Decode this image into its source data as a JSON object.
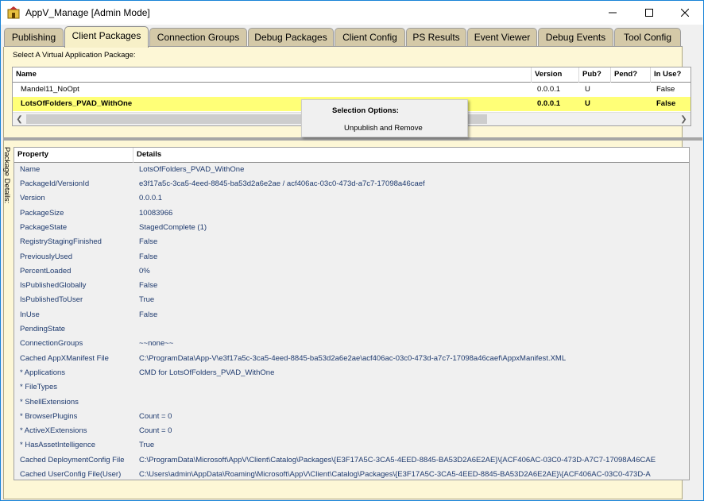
{
  "window": {
    "title": "AppV_Manage [Admin Mode]"
  },
  "tabs": [
    {
      "label": "Publishing",
      "active": false
    },
    {
      "label": "Client Packages",
      "active": true
    },
    {
      "label": "Connection Groups",
      "active": false
    },
    {
      "label": "Debug Packages",
      "active": false
    },
    {
      "label": "Client Config",
      "active": false
    },
    {
      "label": "PS Results",
      "active": false
    },
    {
      "label": "Event Viewer",
      "active": false
    },
    {
      "label": "Debug Events",
      "active": false
    },
    {
      "label": "Tool Config",
      "active": false
    }
  ],
  "packages": {
    "label": "Select A Virtual Application Package:",
    "columns": {
      "name": "Name",
      "version": "Version",
      "pub": "Pub?",
      "pend": "Pend?",
      "inuse": "In Use?"
    },
    "rows": [
      {
        "name": "Mandel11_NoOpt",
        "version": "0.0.0.1",
        "pub": "U",
        "pend": "",
        "inuse": "False",
        "selected": false
      },
      {
        "name": "LotsOfFolders_PVAD_WithOne",
        "version": "0.0.0.1",
        "pub": "U",
        "pend": "",
        "inuse": "False",
        "selected": true
      }
    ]
  },
  "context_menu": {
    "title": "Selection Options:",
    "items": [
      "Unpublish and Remove"
    ]
  },
  "details": {
    "side_label": "Package Details:",
    "columns": {
      "property": "Property",
      "details": "Details"
    },
    "rows": [
      {
        "property": "Name",
        "value": "LotsOfFolders_PVAD_WithOne"
      },
      {
        "property": "PackageId/VersionId",
        "value": "e3f17a5c-3ca5-4eed-8845-ba53d2a6e2ae / acf406ac-03c0-473d-a7c7-17098a46caef"
      },
      {
        "property": "Version",
        "value": "0.0.0.1"
      },
      {
        "property": "PackageSize",
        "value": "10083966"
      },
      {
        "property": "PackageState",
        "value": "StagedComplete (1)"
      },
      {
        "property": "RegistryStagingFinished",
        "value": "False"
      },
      {
        "property": "PreviouslyUsed",
        "value": "False"
      },
      {
        "property": "PercentLoaded",
        "value": "0%"
      },
      {
        "property": "IsPublishedGlobally",
        "value": "False"
      },
      {
        "property": "IsPublishedToUser",
        "value": "True"
      },
      {
        "property": "InUse",
        "value": "False"
      },
      {
        "property": "PendingState",
        "value": ""
      },
      {
        "property": "ConnectionGroups",
        "value": "~~none~~"
      },
      {
        "property": "Cached AppXManifest File",
        "value": "C:\\ProgramData\\App-V\\e3f17a5c-3ca5-4eed-8845-ba53d2a6e2ae\\acf406ac-03c0-473d-a7c7-17098a46caef\\AppxManifest.XML"
      },
      {
        "property": " * Applications",
        "value": "CMD for LotsOfFolders_PVAD_WithOne"
      },
      {
        "property": " * FileTypes",
        "value": ""
      },
      {
        "property": " * ShellExtensions",
        "value": ""
      },
      {
        "property": " * BrowserPlugins",
        "value": "Count = 0"
      },
      {
        "property": " * ActiveXExtensions",
        "value": "Count = 0"
      },
      {
        "property": " * HasAssetIntelligence",
        "value": "True"
      },
      {
        "property": "Cached DeploymentConfig File",
        "value": "C:\\ProgramData\\Microsoft\\AppV\\Client\\Catalog\\Packages\\{E3F17A5C-3CA5-4EED-8845-BA53D2A6E2AE}\\{ACF406AC-03C0-473D-A7C7-17098A46CAE"
      },
      {
        "property": "Cached UserConfig File(User)",
        "value": "C:\\Users\\admin\\AppData\\Roaming\\Microsoft\\AppV\\Client\\Catalog\\Packages\\{E3F17A5C-3CA5-4EED-8845-BA53D2A6E2AE}\\{ACF406AC-03C0-473D-A"
      }
    ]
  }
}
